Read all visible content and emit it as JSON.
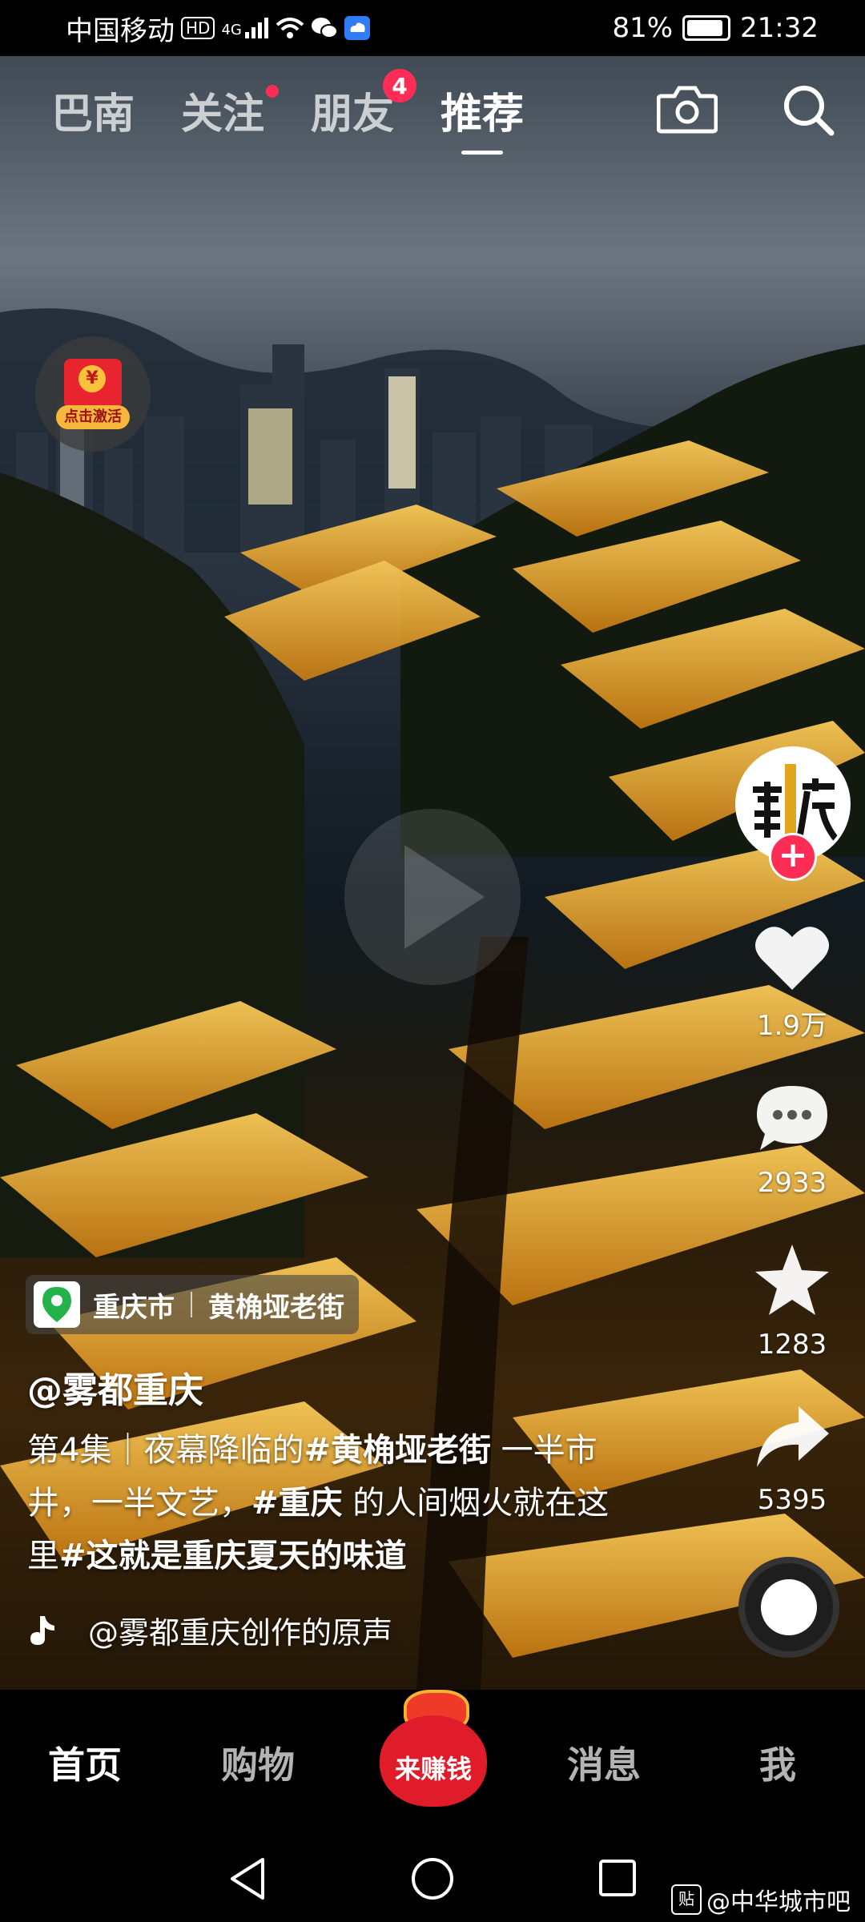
{
  "status_bar": {
    "carrier": "中国移动",
    "network_badge": "HD",
    "signal_label": "4G",
    "battery": "81%",
    "time": "21:32",
    "icons": [
      "signal-icon",
      "wifi-icon",
      "wechat-icon",
      "cloud-icon",
      "battery-icon"
    ]
  },
  "top_tabs": [
    {
      "label": "巴南"
    },
    {
      "label": "关注"
    },
    {
      "label": "朋友",
      "badge": "4"
    },
    {
      "label": "推荐"
    }
  ],
  "top_icons": [
    "camera-icon",
    "search-icon"
  ],
  "hongbao": {
    "coin": "¥",
    "text": "点击激活"
  },
  "actions": {
    "like_count": "1.9万",
    "comment_count": "2933",
    "favorite_count": "1283",
    "share_count": "5395",
    "follow": "+"
  },
  "location": {
    "city": "重庆市",
    "place": "黄桷垭老街"
  },
  "post": {
    "author": "@雾都重庆",
    "caption": {
      "part1": "第4集｜夜幕降临的",
      "tag1": "#黄桷垭老街",
      "part2": " 一半市井，一半文艺，",
      "tag2": "#重庆",
      "part3": " 的人间烟火就在这里",
      "tag3": "#这就是重庆夏天的味道"
    },
    "music": "@雾都重庆创作的原声"
  },
  "bottom_nav": {
    "home": "首页",
    "shop": "购物",
    "earn": "来赚钱",
    "messages": "消息",
    "me": "我"
  },
  "watermark": "@中华城市吧",
  "colors": {
    "accent_red": "#ff2d55",
    "bag_red": "#e01b2a",
    "gold": "#f7b234"
  }
}
